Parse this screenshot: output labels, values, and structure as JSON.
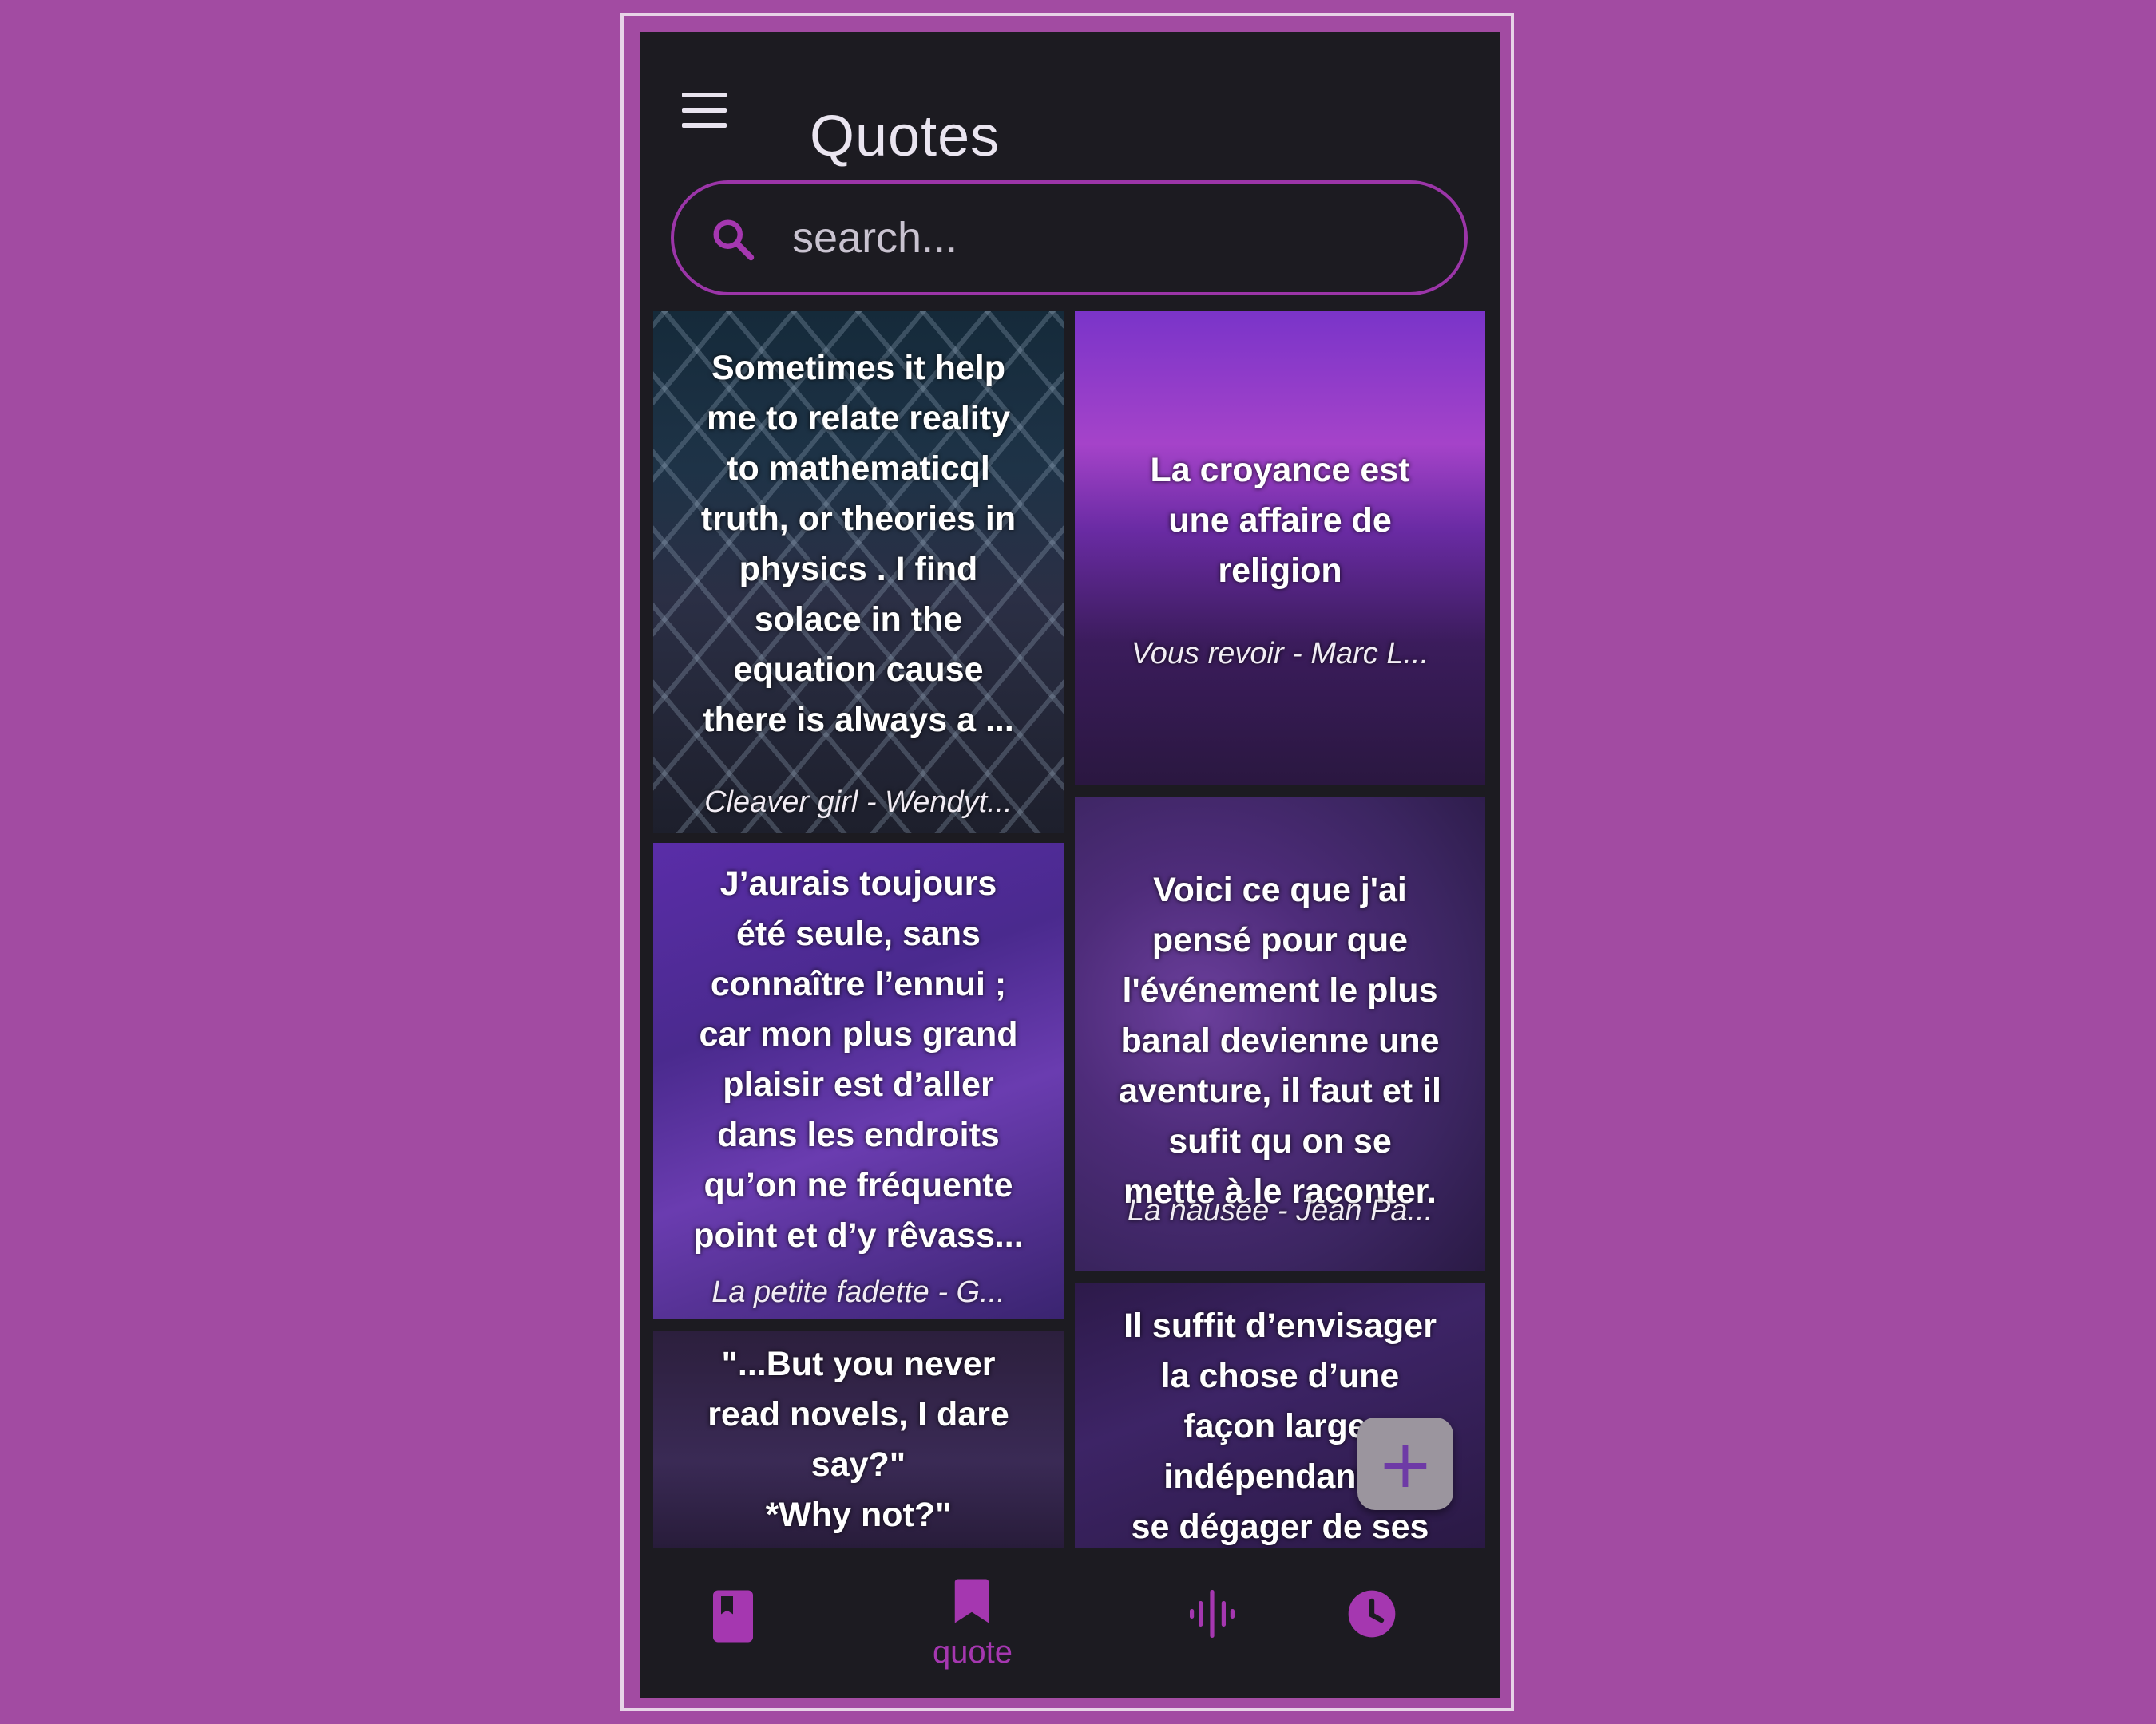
{
  "app": {
    "title": "Quotes"
  },
  "search": {
    "placeholder": "search..."
  },
  "cards": [
    {
      "quote": "Sometimes it help\nme to relate reality\nto mathematicql\ntruth, or theories in\nphysics . I find\nsolace in the\nequation cause\nthere is always a ...",
      "source": "Cleaver girl - Wendyt..."
    },
    {
      "quote": "La croyance est\nune affaire de\nreligion",
      "source": "Vous revoir  - Marc L..."
    },
    {
      "quote": "J’aurais toujours\nété seule, sans\nconnaître l’ennui ;\ncar mon plus grand\nplaisir est d’aller\ndans les endroits\nqu’on ne fréquente\npoint et d’y rêvass...",
      "source": "La petite fadette  - G..."
    },
    {
      "quote": "Voici ce que j'ai\npensé pour que\nl'événement le plus\nbanal devienne une\naventure, il faut et il\nsufit qu on se\nmette à le raconter.",
      "source": "La nausée  - Jean Pa..."
    },
    {
      "quote": "\"...But you never\nread novels, I dare\nsay?\"\n*Why not?\""
    },
    {
      "quote": "Il suffit d’envisager\nla chose d’une\nfaçon large,\nindépendante,\nse dégager de ses"
    }
  ],
  "fab": {
    "label": "+"
  },
  "bottom_nav": {
    "items": [
      {
        "icon": "book-icon",
        "label": ""
      },
      {
        "icon": "bookmark-icon",
        "label": "quote"
      },
      {
        "icon": "audio-wave-icon",
        "label": ""
      },
      {
        "icon": "clock-icon",
        "label": ""
      }
    ]
  },
  "colors": {
    "background": "#a24ba2",
    "surface": "#1c1b21",
    "accent": "#a537b0",
    "search_border": "#9b35a8"
  }
}
